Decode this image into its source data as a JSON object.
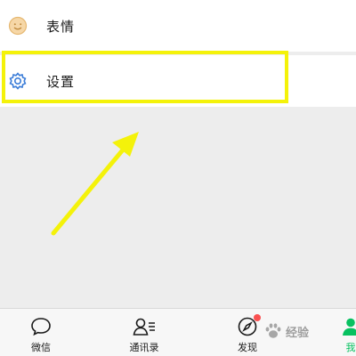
{
  "menu": {
    "items": [
      {
        "label": "表情",
        "icon": "emoji-face-icon"
      },
      {
        "label": "设置",
        "icon": "gear-icon"
      }
    ]
  },
  "annotation": {
    "highlight_color": "#f4f20a",
    "arrow_color": "#f4f20a"
  },
  "tabbar": {
    "tabs": [
      {
        "label": "微信",
        "icon": "chat-bubble-icon",
        "active": false
      },
      {
        "label": "通讯录",
        "icon": "contacts-icon",
        "active": false
      },
      {
        "label": "发现",
        "icon": "compass-icon",
        "active": false,
        "badge": true
      },
      {
        "label": "我",
        "icon": "person-icon",
        "active": true
      }
    ],
    "active_color": "#07c160"
  },
  "watermark": {
    "text": "经验"
  }
}
